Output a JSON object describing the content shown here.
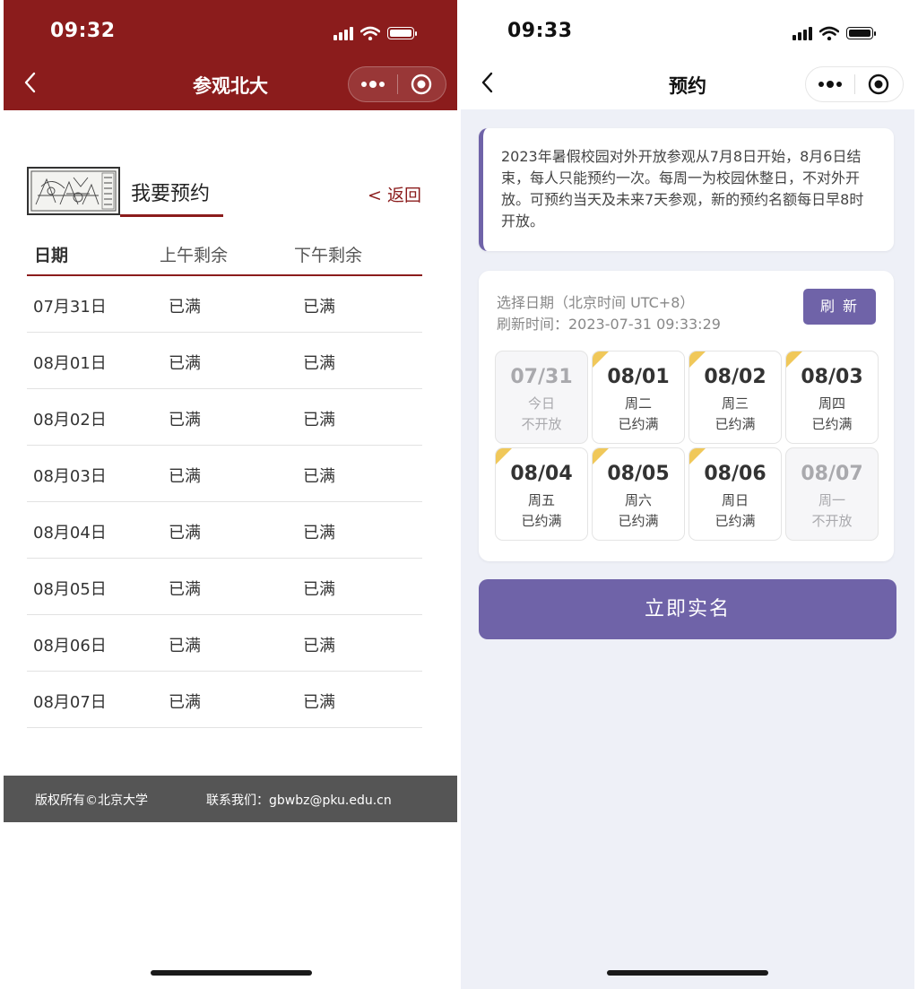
{
  "left": {
    "status": {
      "time": "09:32"
    },
    "nav": {
      "title": "参观北大"
    },
    "heading": "我要预约",
    "back_link": "< 返回",
    "table": {
      "headers": [
        "日期",
        "上午剩余",
        "下午剩余"
      ],
      "rows": [
        [
          "07月31日",
          "已满",
          "已满"
        ],
        [
          "08月01日",
          "已满",
          "已满"
        ],
        [
          "08月02日",
          "已满",
          "已满"
        ],
        [
          "08月03日",
          "已满",
          "已满"
        ],
        [
          "08月04日",
          "已满",
          "已满"
        ],
        [
          "08月05日",
          "已满",
          "已满"
        ],
        [
          "08月06日",
          "已满",
          "已满"
        ],
        [
          "08月07日",
          "已满",
          "已满"
        ]
      ]
    },
    "footer": {
      "copyright": "版权所有©北京大学",
      "contact": "联系我们：gbwbz@pku.edu.cn"
    }
  },
  "right": {
    "status": {
      "time": "09:33"
    },
    "nav": {
      "title": "预约"
    },
    "notice": "2023年暑假校园对外开放参观从7月8日开始，8月6日结束，每人只能预约一次。每周一为校园休整日，不对外开放。可预约当天及未来7天参观，新的预约名额每日早8时开放。",
    "date_select_label": "选择日期（北京时间 UTC+8）",
    "refresh_time": "刷新时间：2023-07-31 09:33:29",
    "refresh_button": "刷 新",
    "dates": [
      {
        "date": "07/31",
        "weekday": "今日",
        "status": "不开放",
        "closed": true
      },
      {
        "date": "08/01",
        "weekday": "周二",
        "status": "已约满",
        "closed": false
      },
      {
        "date": "08/02",
        "weekday": "周三",
        "status": "已约满",
        "closed": false
      },
      {
        "date": "08/03",
        "weekday": "周四",
        "status": "已约满",
        "closed": false
      },
      {
        "date": "08/04",
        "weekday": "周五",
        "status": "已约满",
        "closed": false
      },
      {
        "date": "08/05",
        "weekday": "周六",
        "status": "已约满",
        "closed": false
      },
      {
        "date": "08/06",
        "weekday": "周日",
        "status": "已约满",
        "closed": false
      },
      {
        "date": "08/07",
        "weekday": "周一",
        "status": "不开放",
        "closed": true
      }
    ],
    "main_button": "立即实名"
  },
  "icons": {
    "signal": "signal-icon",
    "wifi": "wifi-icon",
    "battery": "battery-icon",
    "back": "chevron-left-icon",
    "more": "more-icon",
    "record": "target-icon"
  },
  "colors": {
    "pku_red": "#8b1c1c",
    "accent_purple": "#6f63a8",
    "date_corner": "#f0c85a",
    "footer_gray": "#555555",
    "right_bg": "#eef0f7"
  }
}
